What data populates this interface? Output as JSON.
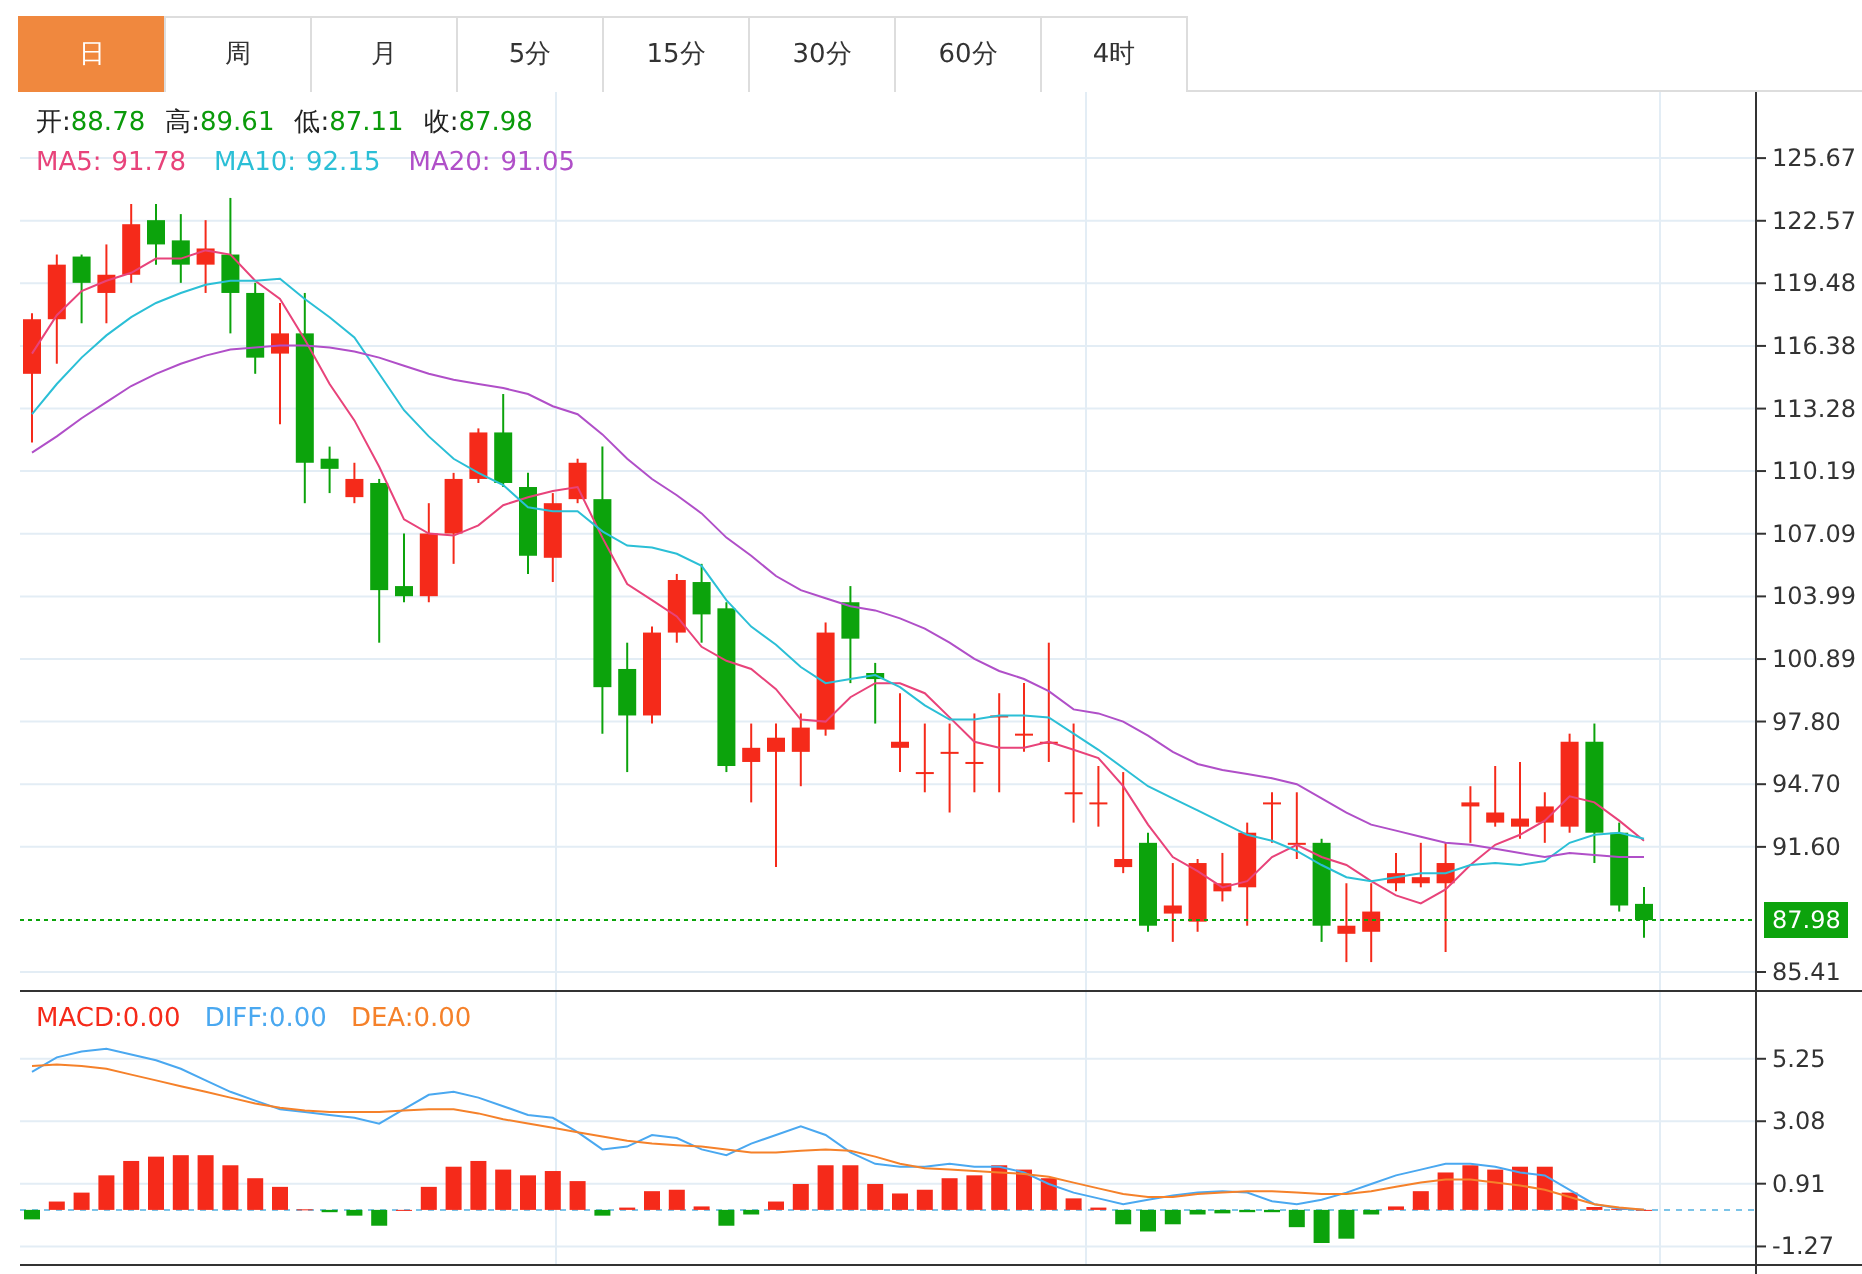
{
  "tabs": [
    {
      "label": "日",
      "selected": true
    },
    {
      "label": "周",
      "selected": false
    },
    {
      "label": "月",
      "selected": false
    },
    {
      "label": "5分",
      "selected": false
    },
    {
      "label": "15分",
      "selected": false
    },
    {
      "label": "30分",
      "selected": false
    },
    {
      "label": "60分",
      "selected": false
    },
    {
      "label": "4时",
      "selected": false
    }
  ],
  "quote": [
    {
      "label": "开:",
      "value": "88.78"
    },
    {
      "label": "高:",
      "value": "89.61"
    },
    {
      "label": "低:",
      "value": "87.11"
    },
    {
      "label": "收:",
      "value": "87.98"
    }
  ],
  "ma_legend": [
    {
      "label": "MA5:",
      "value": "91.78",
      "color": "#e8437a"
    },
    {
      "label": "MA10:",
      "value": "92.15",
      "color": "#2bbfd6"
    },
    {
      "label": "MA20:",
      "value": "91.05",
      "color": "#b04fc8"
    }
  ],
  "price_chart": {
    "chart_data": {
      "type": "candlestick",
      "grid": true,
      "ylim": [
        84.52,
        128.94
      ],
      "ref_lines": [
        {
          "axis": "y",
          "value": 87.98,
          "label": "87.98",
          "color": "#0ca30c"
        }
      ],
      "yticks": [
        {
          "value": 125.67,
          "label": "125.67"
        },
        {
          "value": 122.57,
          "label": "122.57"
        },
        {
          "value": 119.48,
          "label": "119.48"
        },
        {
          "value": 116.38,
          "label": "116.38"
        },
        {
          "value": 113.28,
          "label": "113.28"
        },
        {
          "value": 110.19,
          "label": "110.19"
        },
        {
          "value": 107.09,
          "label": "107.09"
        },
        {
          "value": 103.99,
          "label": "103.99"
        },
        {
          "value": 100.89,
          "label": "100.89"
        },
        {
          "value": 97.8,
          "label": "97.80"
        },
        {
          "value": 94.7,
          "label": "94.70"
        },
        {
          "value": 91.6,
          "label": "91.60"
        },
        {
          "value": 85.41,
          "label": "85.41"
        }
      ],
      "series": [
        {
          "type": "line",
          "color": "#e8437a",
          "values": [
            116.0,
            117.9,
            119.1,
            119.6,
            120.0,
            120.7,
            120.7,
            121.1,
            120.9,
            119.6,
            118.7,
            116.7,
            114.5,
            112.7,
            110.4,
            107.8,
            107.1,
            107.0,
            107.5,
            108.5,
            108.9,
            109.2,
            109.4,
            106.9,
            104.6,
            103.8,
            103.0,
            101.5,
            100.8,
            100.4,
            99.4,
            97.9,
            97.8,
            99.0,
            99.7,
            99.7,
            99.2,
            98.0,
            96.8,
            96.5,
            96.5,
            96.8,
            96.4,
            96.0,
            94.6,
            92.7,
            91.1,
            90.4,
            89.6,
            89.9,
            91.1,
            91.7,
            91.1,
            90.7,
            89.9,
            89.2,
            88.8,
            89.5,
            90.7,
            91.7,
            92.2,
            92.9,
            94.1,
            93.8,
            92.9,
            91.9
          ]
        },
        {
          "type": "line",
          "color": "#2bbfd6",
          "values": [
            113.0,
            114.5,
            115.8,
            116.9,
            117.8,
            118.5,
            119.0,
            119.4,
            119.6,
            119.6,
            119.7,
            118.7,
            117.8,
            116.8,
            115.0,
            113.2,
            111.9,
            110.8,
            110.1,
            109.5,
            108.4,
            108.2,
            108.2,
            107.2,
            106.5,
            106.4,
            106.1,
            105.5,
            103.8,
            102.5,
            101.6,
            100.5,
            99.7,
            99.9,
            100.1,
            99.5,
            98.6,
            97.9,
            97.9,
            98.1,
            98.1,
            98.0,
            97.2,
            96.4,
            95.5,
            94.6,
            94.0,
            93.4,
            92.8,
            92.2,
            91.9,
            91.4,
            90.7,
            90.1,
            89.9,
            90.1,
            90.3,
            90.3,
            90.7,
            90.8,
            90.7,
            90.9,
            91.8,
            92.2,
            92.3,
            92.0
          ]
        },
        {
          "type": "line",
          "color": "#b04fc8",
          "values": [
            111.1,
            111.9,
            112.8,
            113.6,
            114.4,
            115.0,
            115.5,
            115.9,
            116.2,
            116.3,
            116.4,
            116.4,
            116.3,
            116.1,
            115.8,
            115.4,
            115.0,
            114.7,
            114.5,
            114.3,
            114.0,
            113.4,
            113.0,
            112.0,
            110.8,
            109.8,
            109.0,
            108.1,
            106.9,
            106.0,
            105.0,
            104.3,
            103.9,
            103.5,
            103.3,
            102.9,
            102.4,
            101.7,
            100.9,
            100.3,
            99.9,
            99.3,
            98.4,
            98.2,
            97.8,
            97.1,
            96.3,
            95.7,
            95.4,
            95.2,
            95.0,
            94.7,
            94.0,
            93.3,
            92.7,
            92.4,
            92.1,
            91.8,
            91.7,
            91.5,
            91.3,
            91.1,
            91.3,
            91.2,
            91.1,
            91.1
          ]
        }
      ],
      "ohlc": [
        [
          115.0,
          118.0,
          111.6,
          117.7
        ],
        [
          117.7,
          120.9,
          115.5,
          120.4
        ],
        [
          120.8,
          120.9,
          117.5,
          119.5
        ],
        [
          119.0,
          121.4,
          117.5,
          119.9
        ],
        [
          119.9,
          123.4,
          119.5,
          122.4
        ],
        [
          122.6,
          123.4,
          120.4,
          121.4
        ],
        [
          121.6,
          122.9,
          119.5,
          120.4
        ],
        [
          120.4,
          122.6,
          119.0,
          121.2
        ],
        [
          120.9,
          123.7,
          117.0,
          119.0
        ],
        [
          119.0,
          119.5,
          115.0,
          115.8
        ],
        [
          116.0,
          118.5,
          112.5,
          117.0
        ],
        [
          117.0,
          119.0,
          108.6,
          110.6
        ],
        [
          110.8,
          111.4,
          109.1,
          110.3
        ],
        [
          108.9,
          110.6,
          108.6,
          109.8
        ],
        [
          109.6,
          109.8,
          101.7,
          104.3
        ],
        [
          104.5,
          107.1,
          103.7,
          104.0
        ],
        [
          104.0,
          108.6,
          103.7,
          107.1
        ],
        [
          107.1,
          110.1,
          105.6,
          109.8
        ],
        [
          109.8,
          112.3,
          109.6,
          112.1
        ],
        [
          112.1,
          114.0,
          109.4,
          109.6
        ],
        [
          109.4,
          110.1,
          105.1,
          106.0
        ],
        [
          105.9,
          109.1,
          104.7,
          108.6
        ],
        [
          108.8,
          110.8,
          108.6,
          110.6
        ],
        [
          108.8,
          111.4,
          97.2,
          99.5
        ],
        [
          100.4,
          101.7,
          95.3,
          98.1
        ],
        [
          98.1,
          102.5,
          97.7,
          102.2
        ],
        [
          102.2,
          105.1,
          101.7,
          104.8
        ],
        [
          104.7,
          105.6,
          101.7,
          103.1
        ],
        [
          103.4,
          103.7,
          95.3,
          95.6
        ],
        [
          95.8,
          97.7,
          93.8,
          96.5
        ],
        [
          96.3,
          97.7,
          90.6,
          97.0
        ],
        [
          96.3,
          98.2,
          94.6,
          97.5
        ],
        [
          97.4,
          102.7,
          97.1,
          102.2
        ],
        [
          103.7,
          104.5,
          99.7,
          101.9
        ],
        [
          100.2,
          100.7,
          97.7,
          99.9
        ],
        [
          96.5,
          99.2,
          95.3,
          96.8
        ],
        [
          95.3,
          97.7,
          94.3,
          95.3
        ],
        [
          96.3,
          97.7,
          93.3,
          96.3
        ],
        [
          95.8,
          98.2,
          94.3,
          95.8
        ],
        [
          98.1,
          99.2,
          94.3,
          98.1
        ],
        [
          97.2,
          99.7,
          96.3,
          97.2
        ],
        [
          96.8,
          101.7,
          95.8,
          96.8
        ],
        [
          94.3,
          97.7,
          92.8,
          94.3
        ],
        [
          93.8,
          95.6,
          92.6,
          93.8
        ],
        [
          90.6,
          95.3,
          90.3,
          91.0
        ],
        [
          91.8,
          92.3,
          87.4,
          87.7
        ],
        [
          88.3,
          90.8,
          86.9,
          88.7
        ],
        [
          87.9,
          91.0,
          87.4,
          90.8
        ],
        [
          89.4,
          91.3,
          88.9,
          89.8
        ],
        [
          89.6,
          92.8,
          87.7,
          92.3
        ],
        [
          93.8,
          94.3,
          91.8,
          93.8
        ],
        [
          91.8,
          94.3,
          91.0,
          91.8
        ],
        [
          91.8,
          92.0,
          86.9,
          87.7
        ],
        [
          87.3,
          89.8,
          85.9,
          87.7
        ],
        [
          87.4,
          89.8,
          85.9,
          88.4
        ],
        [
          89.8,
          91.3,
          89.4,
          90.3
        ],
        [
          89.8,
          91.8,
          89.6,
          90.1
        ],
        [
          89.8,
          91.8,
          86.4,
          90.8
        ],
        [
          93.6,
          94.6,
          91.8,
          93.8
        ],
        [
          92.8,
          95.6,
          92.6,
          93.3
        ],
        [
          92.6,
          95.8,
          92.0,
          93.0
        ],
        [
          92.8,
          94.3,
          91.8,
          93.6
        ],
        [
          92.6,
          97.2,
          92.3,
          96.8
        ],
        [
          96.8,
          97.7,
          90.8,
          92.3
        ],
        [
          92.3,
          92.8,
          88.4,
          88.7
        ],
        [
          88.78,
          89.61,
          87.11,
          87.98
        ]
      ]
    }
  },
  "macd_chart": {
    "legend": [
      {
        "label": "MACD:",
        "value": "0.00",
        "color": "#f52a1a"
      },
      {
        "label": "DIFF:",
        "value": "0.00",
        "color": "#4aa8f0"
      },
      {
        "label": "DEA:",
        "value": "0.00",
        "color": "#f5812a"
      }
    ],
    "chart_data": {
      "type": "bar",
      "grid": true,
      "stacked": false,
      "ylim": [
        -1.88,
        7.57
      ],
      "ref_lines": [
        {
          "axis": "y",
          "value": 0,
          "color": "#7cc4e8"
        }
      ],
      "yticks": [
        {
          "value": 5.25,
          "label": "5.25"
        },
        {
          "value": 3.08,
          "label": "3.08"
        },
        {
          "value": 0.91,
          "label": "0.91"
        },
        {
          "value": -1.27,
          "label": "-1.27"
        }
      ],
      "series": [
        {
          "colors": [
            "#0ca30c",
            "#f52a1a",
            "#f52a1a",
            "#f52a1a",
            "#f52a1a",
            "#f52a1a",
            "#f52a1a",
            "#f52a1a",
            "#f52a1a",
            "#f52a1a",
            "#f52a1a",
            "#f52a1a",
            "#0ca30c",
            "#0ca30c",
            "#0ca30c",
            "#f52a1a",
            "#f52a1a",
            "#f52a1a",
            "#f52a1a",
            "#f52a1a",
            "#f52a1a",
            "#f52a1a",
            "#f52a1a",
            "#0ca30c",
            "#f52a1a",
            "#f52a1a",
            "#f52a1a",
            "#f52a1a",
            "#0ca30c",
            "#0ca30c",
            "#f52a1a",
            "#f52a1a",
            "#f52a1a",
            "#f52a1a",
            "#f52a1a",
            "#f52a1a",
            "#f52a1a",
            "#f52a1a",
            "#f52a1a",
            "#f52a1a",
            "#f52a1a",
            "#f52a1a",
            "#f52a1a",
            "#f52a1a",
            "#0ca30c",
            "#0ca30c",
            "#0ca30c",
            "#0ca30c",
            "#0ca30c",
            "#0ca30c",
            "#0ca30c",
            "#0ca30c",
            "#0ca30c",
            "#0ca30c",
            "#0ca30c",
            "#f52a1a",
            "#f52a1a",
            "#f52a1a",
            "#f52a1a",
            "#f52a1a",
            "#f52a1a",
            "#f52a1a",
            "#f52a1a",
            "#f52a1a",
            "#f52a1a",
            "#f52a1a"
          ],
          "values": [
            -0.33,
            0.29,
            0.6,
            1.2,
            1.7,
            1.85,
            1.9,
            1.9,
            1.55,
            1.1,
            0.8,
            0.02,
            -0.08,
            -0.2,
            -0.55,
            0,
            0.8,
            1.5,
            1.7,
            1.4,
            1.2,
            1.35,
            1.0,
            -0.2,
            0.08,
            0.65,
            0.7,
            0.12,
            -0.55,
            -0.16,
            0.29,
            0.9,
            1.55,
            1.55,
            0.9,
            0.57,
            0.7,
            1.1,
            1.2,
            1.55,
            1.4,
            1.1,
            0.4,
            0.08,
            -0.5,
            -0.75,
            -0.5,
            -0.16,
            -0.12,
            -0.08,
            -0.08,
            -0.6,
            -1.15,
            -1.0,
            -0.16,
            0.12,
            0.65,
            1.3,
            1.55,
            1.4,
            1.5,
            1.5,
            0.6,
            0.1,
            0.04,
            0
          ]
        },
        {
          "type": "line",
          "color": "#4aa8f0",
          "values": [
            4.8,
            5.3,
            5.5,
            5.6,
            5.4,
            5.2,
            4.9,
            4.5,
            4.1,
            3.8,
            3.5,
            3.4,
            3.3,
            3.2,
            3.0,
            3.5,
            4.0,
            4.1,
            3.9,
            3.6,
            3.3,
            3.2,
            2.7,
            2.1,
            2.2,
            2.6,
            2.5,
            2.1,
            1.9,
            2.3,
            2.6,
            2.9,
            2.6,
            2.0,
            1.6,
            1.5,
            1.5,
            1.6,
            1.5,
            1.5,
            1.3,
            0.9,
            0.6,
            0.4,
            0.2,
            0.35,
            0.5,
            0.6,
            0.65,
            0.6,
            0.3,
            0.2,
            0.35,
            0.6,
            0.9,
            1.2,
            1.4,
            1.6,
            1.6,
            1.5,
            1.3,
            1.2,
            0.7,
            0.2,
            0.05,
            0.0
          ]
        },
        {
          "type": "line",
          "color": "#f5812a",
          "values": [
            5.0,
            5.05,
            5.0,
            4.9,
            4.7,
            4.5,
            4.3,
            4.1,
            3.9,
            3.7,
            3.55,
            3.45,
            3.4,
            3.4,
            3.4,
            3.45,
            3.5,
            3.5,
            3.35,
            3.15,
            3.0,
            2.85,
            2.7,
            2.55,
            2.4,
            2.3,
            2.25,
            2.2,
            2.1,
            2.0,
            2.0,
            2.05,
            2.1,
            2.05,
            1.85,
            1.6,
            1.45,
            1.4,
            1.35,
            1.3,
            1.25,
            1.15,
            0.95,
            0.75,
            0.55,
            0.45,
            0.45,
            0.55,
            0.6,
            0.65,
            0.65,
            0.6,
            0.55,
            0.55,
            0.65,
            0.8,
            0.95,
            1.05,
            1.05,
            0.95,
            0.85,
            0.7,
            0.45,
            0.2,
            0.08,
            0.0
          ]
        }
      ]
    }
  }
}
